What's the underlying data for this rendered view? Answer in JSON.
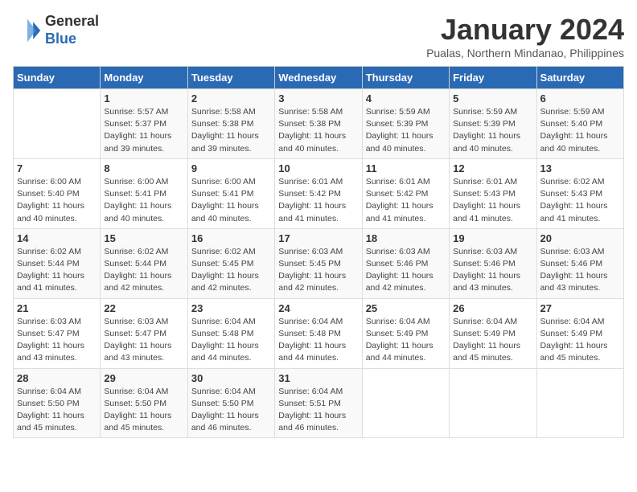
{
  "header": {
    "logo_line1": "General",
    "logo_line2": "Blue",
    "month": "January 2024",
    "location": "Pualas, Northern Mindanao, Philippines"
  },
  "days_of_week": [
    "Sunday",
    "Monday",
    "Tuesday",
    "Wednesday",
    "Thursday",
    "Friday",
    "Saturday"
  ],
  "weeks": [
    [
      {
        "day": "",
        "info": ""
      },
      {
        "day": "1",
        "info": "Sunrise: 5:57 AM\nSunset: 5:37 PM\nDaylight: 11 hours\nand 39 minutes."
      },
      {
        "day": "2",
        "info": "Sunrise: 5:58 AM\nSunset: 5:38 PM\nDaylight: 11 hours\nand 39 minutes."
      },
      {
        "day": "3",
        "info": "Sunrise: 5:58 AM\nSunset: 5:38 PM\nDaylight: 11 hours\nand 40 minutes."
      },
      {
        "day": "4",
        "info": "Sunrise: 5:59 AM\nSunset: 5:39 PM\nDaylight: 11 hours\nand 40 minutes."
      },
      {
        "day": "5",
        "info": "Sunrise: 5:59 AM\nSunset: 5:39 PM\nDaylight: 11 hours\nand 40 minutes."
      },
      {
        "day": "6",
        "info": "Sunrise: 5:59 AM\nSunset: 5:40 PM\nDaylight: 11 hours\nand 40 minutes."
      }
    ],
    [
      {
        "day": "7",
        "info": "Sunrise: 6:00 AM\nSunset: 5:40 PM\nDaylight: 11 hours\nand 40 minutes."
      },
      {
        "day": "8",
        "info": "Sunrise: 6:00 AM\nSunset: 5:41 PM\nDaylight: 11 hours\nand 40 minutes."
      },
      {
        "day": "9",
        "info": "Sunrise: 6:00 AM\nSunset: 5:41 PM\nDaylight: 11 hours\nand 40 minutes."
      },
      {
        "day": "10",
        "info": "Sunrise: 6:01 AM\nSunset: 5:42 PM\nDaylight: 11 hours\nand 41 minutes."
      },
      {
        "day": "11",
        "info": "Sunrise: 6:01 AM\nSunset: 5:42 PM\nDaylight: 11 hours\nand 41 minutes."
      },
      {
        "day": "12",
        "info": "Sunrise: 6:01 AM\nSunset: 5:43 PM\nDaylight: 11 hours\nand 41 minutes."
      },
      {
        "day": "13",
        "info": "Sunrise: 6:02 AM\nSunset: 5:43 PM\nDaylight: 11 hours\nand 41 minutes."
      }
    ],
    [
      {
        "day": "14",
        "info": "Sunrise: 6:02 AM\nSunset: 5:44 PM\nDaylight: 11 hours\nand 41 minutes."
      },
      {
        "day": "15",
        "info": "Sunrise: 6:02 AM\nSunset: 5:44 PM\nDaylight: 11 hours\nand 42 minutes."
      },
      {
        "day": "16",
        "info": "Sunrise: 6:02 AM\nSunset: 5:45 PM\nDaylight: 11 hours\nand 42 minutes."
      },
      {
        "day": "17",
        "info": "Sunrise: 6:03 AM\nSunset: 5:45 PM\nDaylight: 11 hours\nand 42 minutes."
      },
      {
        "day": "18",
        "info": "Sunrise: 6:03 AM\nSunset: 5:46 PM\nDaylight: 11 hours\nand 42 minutes."
      },
      {
        "day": "19",
        "info": "Sunrise: 6:03 AM\nSunset: 5:46 PM\nDaylight: 11 hours\nand 43 minutes."
      },
      {
        "day": "20",
        "info": "Sunrise: 6:03 AM\nSunset: 5:46 PM\nDaylight: 11 hours\nand 43 minutes."
      }
    ],
    [
      {
        "day": "21",
        "info": "Sunrise: 6:03 AM\nSunset: 5:47 PM\nDaylight: 11 hours\nand 43 minutes."
      },
      {
        "day": "22",
        "info": "Sunrise: 6:03 AM\nSunset: 5:47 PM\nDaylight: 11 hours\nand 43 minutes."
      },
      {
        "day": "23",
        "info": "Sunrise: 6:04 AM\nSunset: 5:48 PM\nDaylight: 11 hours\nand 44 minutes."
      },
      {
        "day": "24",
        "info": "Sunrise: 6:04 AM\nSunset: 5:48 PM\nDaylight: 11 hours\nand 44 minutes."
      },
      {
        "day": "25",
        "info": "Sunrise: 6:04 AM\nSunset: 5:49 PM\nDaylight: 11 hours\nand 44 minutes."
      },
      {
        "day": "26",
        "info": "Sunrise: 6:04 AM\nSunset: 5:49 PM\nDaylight: 11 hours\nand 45 minutes."
      },
      {
        "day": "27",
        "info": "Sunrise: 6:04 AM\nSunset: 5:49 PM\nDaylight: 11 hours\nand 45 minutes."
      }
    ],
    [
      {
        "day": "28",
        "info": "Sunrise: 6:04 AM\nSunset: 5:50 PM\nDaylight: 11 hours\nand 45 minutes."
      },
      {
        "day": "29",
        "info": "Sunrise: 6:04 AM\nSunset: 5:50 PM\nDaylight: 11 hours\nand 45 minutes."
      },
      {
        "day": "30",
        "info": "Sunrise: 6:04 AM\nSunset: 5:50 PM\nDaylight: 11 hours\nand 46 minutes."
      },
      {
        "day": "31",
        "info": "Sunrise: 6:04 AM\nSunset: 5:51 PM\nDaylight: 11 hours\nand 46 minutes."
      },
      {
        "day": "",
        "info": ""
      },
      {
        "day": "",
        "info": ""
      },
      {
        "day": "",
        "info": ""
      }
    ]
  ]
}
